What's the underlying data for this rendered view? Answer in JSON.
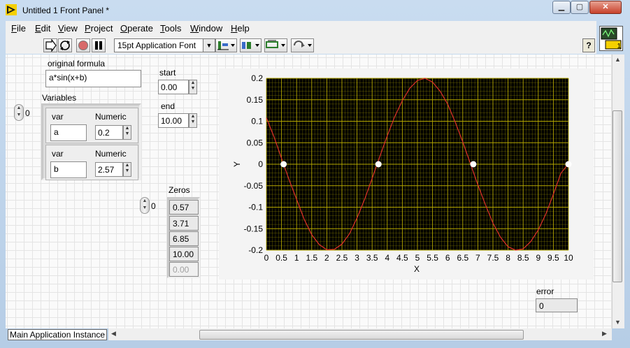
{
  "window": {
    "title": "Untitled 1 Front Panel *",
    "close_glyph": "✕",
    "min_glyph": "▁",
    "max_glyph": "▢"
  },
  "menu": [
    {
      "label": "File",
      "u": "F",
      "rest": "ile"
    },
    {
      "label": "Edit",
      "u": "E",
      "rest": "dit"
    },
    {
      "label": "View",
      "u": "V",
      "rest": "iew"
    },
    {
      "label": "Project",
      "u": "P",
      "rest": "roject"
    },
    {
      "label": "Operate",
      "u": "O",
      "rest": "perate"
    },
    {
      "label": "Tools",
      "u": "T",
      "rest": "ools"
    },
    {
      "label": "Window",
      "u": "W",
      "rest": "indow"
    },
    {
      "label": "Help",
      "u": "H",
      "rest": "elp"
    }
  ],
  "toolbar": {
    "font": "15pt Application Font",
    "help": "?",
    "icons": [
      "run-arrow-icon",
      "run-continuously-icon",
      "abort-icon",
      "pause-icon",
      "align-objects-icon",
      "distribute-objects-icon",
      "resize-objects-icon",
      "reorder-icon"
    ],
    "vi_icon_number": "1"
  },
  "controls": {
    "formula_label": "original formula",
    "formula_value": "a*sin(x+b)",
    "start_label": "start",
    "start_value": "0.00",
    "end_label": "end",
    "end_value": "10.00",
    "variables_label": "Variables",
    "variables_index": "0",
    "variables": [
      {
        "var_label": "var",
        "var_value": "a",
        "num_label": "Numeric",
        "num_value": "0.2"
      },
      {
        "var_label": "var",
        "var_value": "b",
        "num_label": "Numeric",
        "num_value": "2.57"
      }
    ],
    "zeros_label": "Zeros",
    "zeros_index": "0",
    "zeros": [
      "0.57",
      "3.71",
      "6.85",
      "10.00"
    ],
    "zeros_empty": "0.00",
    "error_label": "error",
    "error_value": "0"
  },
  "status_bar": {
    "instance": "Main Application Instance"
  },
  "colors": {
    "plot_bg": "#000000",
    "grid": "#b5a800",
    "curve": "#e0302a",
    "marker": "#ffffff"
  },
  "chart_data": {
    "type": "line",
    "title": "",
    "xlabel": "X",
    "ylabel": "Y",
    "xlim": [
      0,
      10
    ],
    "ylim": [
      -0.2,
      0.2
    ],
    "x_ticks": [
      "0",
      "0.5",
      "1",
      "1.5",
      "2",
      "2.5",
      "3",
      "3.5",
      "4",
      "4.5",
      "5",
      "5.5",
      "6",
      "6.5",
      "7",
      "7.5",
      "8",
      "8.5",
      "9",
      "9.5",
      "10"
    ],
    "y_ticks": [
      "0.2",
      "0.15",
      "0.1",
      "0.05",
      "0",
      "-0.05",
      "-0.1",
      "-0.15",
      "-0.2"
    ],
    "series": [
      {
        "formula": "0.2*sin(x+2.57)",
        "x": [
          0,
          0.25,
          0.5,
          0.75,
          1,
          1.25,
          1.5,
          1.75,
          2,
          2.25,
          2.5,
          2.75,
          3,
          3.25,
          3.5,
          3.75,
          4,
          4.25,
          4.5,
          4.75,
          5,
          5.25,
          5.5,
          5.75,
          6,
          6.25,
          6.5,
          6.75,
          7,
          7.25,
          7.5,
          7.75,
          8,
          8.25,
          8.5,
          8.75,
          9,
          9.25,
          9.5,
          9.75,
          10
        ],
        "y": [
          0.108,
          0.064,
          0.014,
          -0.036,
          -0.082,
          -0.128,
          -0.164,
          -0.187,
          -0.199,
          -0.198,
          -0.186,
          -0.162,
          -0.125,
          -0.082,
          -0.033,
          0.017,
          0.066,
          0.111,
          0.148,
          0.177,
          0.195,
          0.2,
          0.191,
          0.17,
          0.14,
          0.098,
          0.052,
          0.002,
          -0.048,
          -0.094,
          -0.137,
          -0.17,
          -0.192,
          -0.2,
          -0.197,
          -0.18,
          -0.153,
          -0.116,
          -0.07,
          -0.021,
          0.001
        ]
      },
      {
        "markers": true,
        "x": [
          0.57,
          3.71,
          6.85,
          10.0
        ],
        "y": [
          0,
          0,
          0,
          0
        ]
      }
    ]
  }
}
